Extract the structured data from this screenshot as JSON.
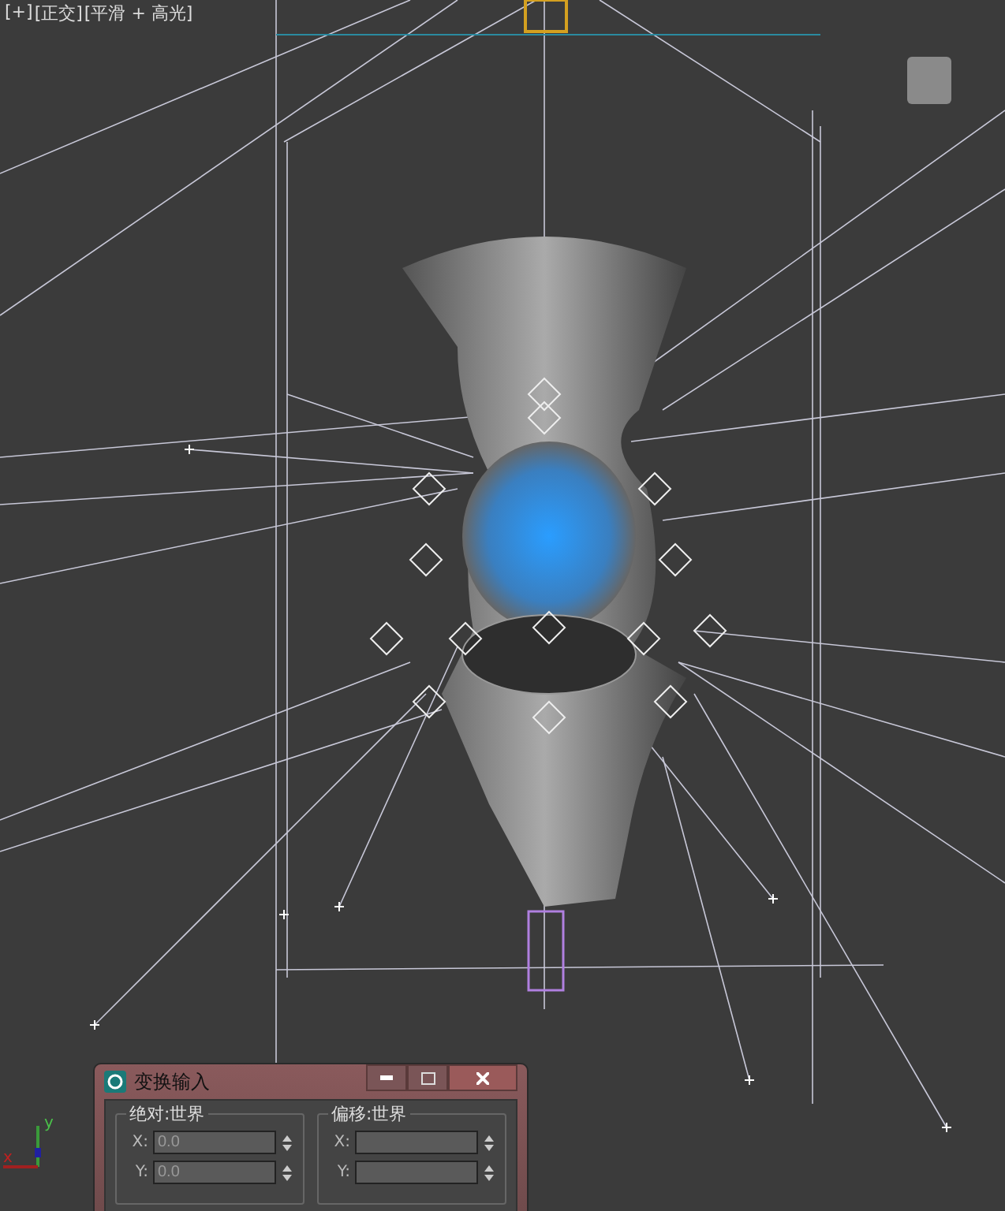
{
  "viewport": {
    "labels": [
      "[+]",
      "[正交]",
      "[平滑 + 高光]"
    ],
    "axis": {
      "x": "x",
      "y": "y"
    }
  },
  "dialog": {
    "title": "变换输入",
    "groups": [
      {
        "title": "绝对:世界",
        "fields": [
          {
            "label": "X:",
            "value": "0.0"
          },
          {
            "label": "Y:",
            "value": "0.0"
          }
        ]
      },
      {
        "title": "偏移:世界",
        "fields": [
          {
            "label": "X:"
          },
          {
            "label": "Y:"
          }
        ]
      }
    ]
  }
}
